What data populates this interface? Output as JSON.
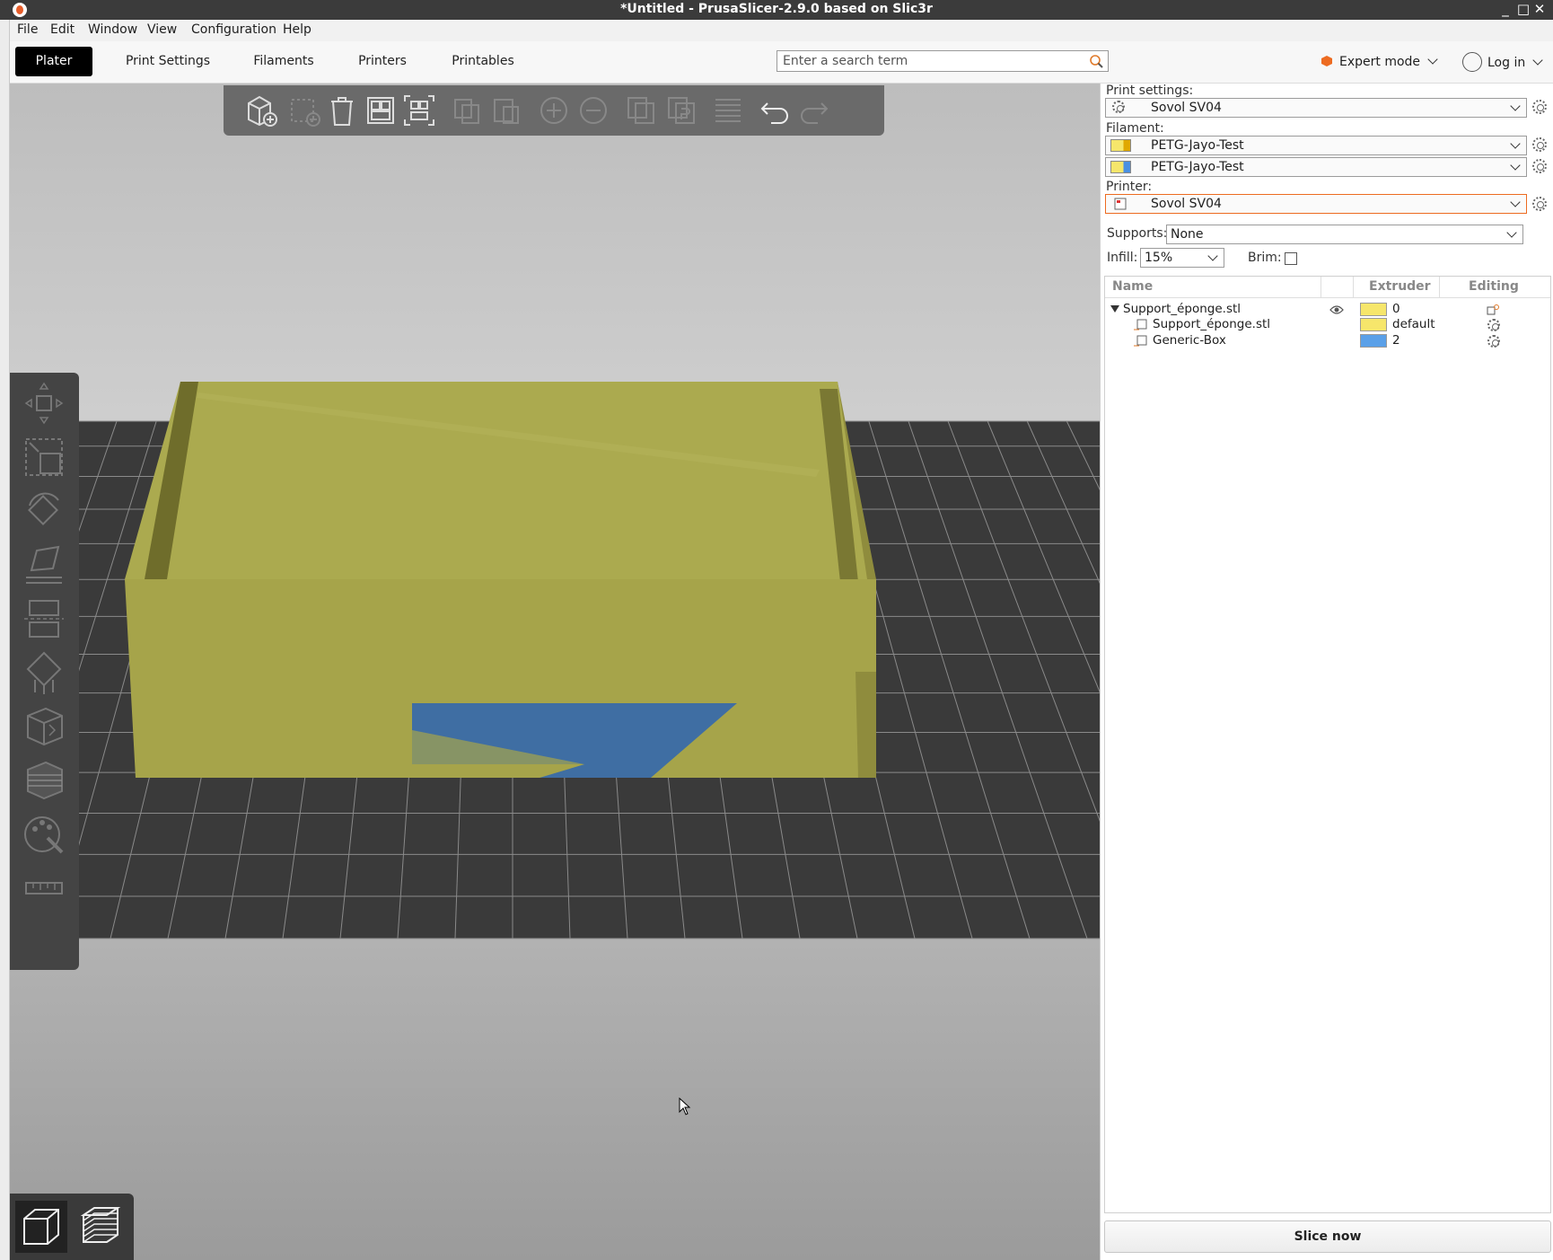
{
  "window": {
    "title": "*Untitled - PrusaSlicer-2.9.0 based on Slic3r",
    "controls": [
      "_",
      "□",
      "✕"
    ]
  },
  "menu": [
    "File",
    "Edit",
    "Window",
    "View",
    "Configuration",
    "Help"
  ],
  "tabs": [
    "Plater",
    "Print Settings",
    "Filaments",
    "Printers",
    "Printables"
  ],
  "search": {
    "placeholder": "Enter a search term"
  },
  "mode": {
    "label": "Expert mode",
    "color": "#ed6b21"
  },
  "account": {
    "label": "Log in"
  },
  "right_panel": {
    "print_settings_label": "Print settings:",
    "print_settings_value": "Sovol SV04",
    "filament_label": "Filament:",
    "filaments": [
      {
        "name": "PETG-Jayo-Test",
        "color": "#f6e66b",
        "accent": "#e0a800"
      },
      {
        "name": "PETG-Jayo-Test",
        "color": "#f6e66b",
        "accent": "#4a90e2"
      }
    ],
    "printer_label": "Printer:",
    "printer_value": "Sovol SV04",
    "supports_label": "Supports:",
    "supports_value": "None",
    "infill_label": "Infill:",
    "infill_value": "15%",
    "brim_label": "Brim:",
    "brim_checked": false,
    "object_list": {
      "columns": [
        "Name",
        "Extruder",
        "Editing"
      ],
      "rows": [
        {
          "name": "Support_éponge.stl",
          "extruder": "0",
          "color": "#f6e66b",
          "level": 0
        },
        {
          "name": "Support_éponge.stl",
          "extruder": "default",
          "color": "#f6e66b",
          "level": 1
        },
        {
          "name": "Generic-Box",
          "extruder": "2",
          "color": "#5aa0e8",
          "level": 1
        }
      ]
    },
    "slice_button": "Slice now"
  },
  "colors": {
    "model_yellow": "#a8a64c",
    "model_blue": "#3f6ea3",
    "bed": "#3e3e3e",
    "accent": "#ed6b21"
  }
}
